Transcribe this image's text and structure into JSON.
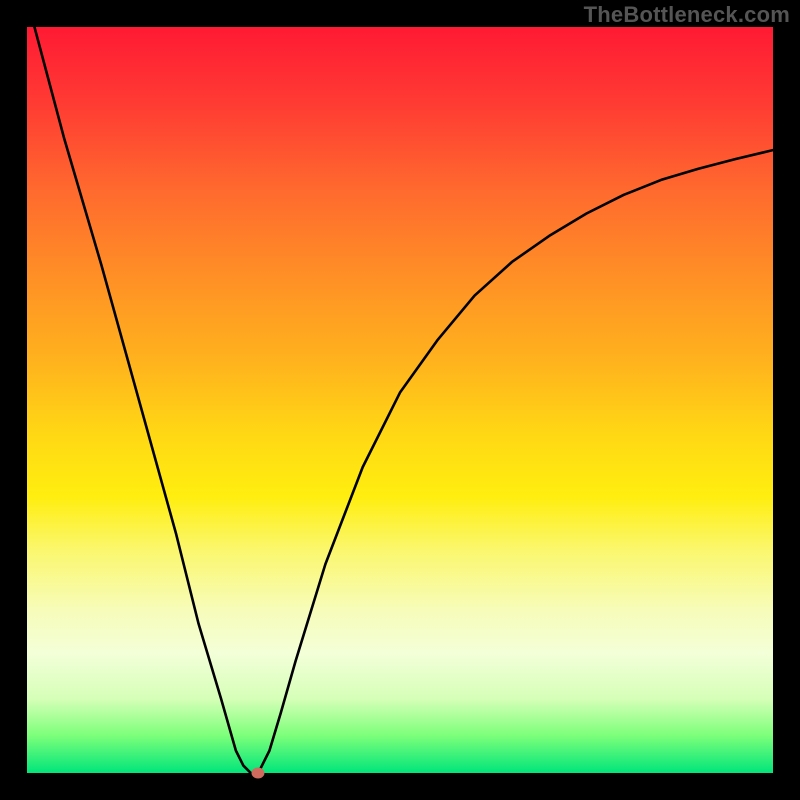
{
  "watermark": "TheBottleneck.com",
  "chart_data": {
    "type": "line",
    "title": "",
    "xlabel": "",
    "ylabel": "",
    "xlim": [
      0,
      100
    ],
    "ylim": [
      0,
      100
    ],
    "background_gradient": {
      "top": "#ff1a33",
      "middle": "#ffd914",
      "bottom": "#00e57a"
    },
    "series": [
      {
        "name": "bottleneck-curve",
        "color": "#000000",
        "x": [
          1,
          5,
          10,
          15,
          20,
          23,
          26,
          28,
          29,
          30,
          31,
          32.5,
          34,
          36,
          40,
          45,
          50,
          55,
          60,
          65,
          70,
          75,
          80,
          85,
          90,
          95,
          100
        ],
        "y": [
          100,
          85,
          68,
          50,
          32,
          20,
          10,
          3,
          1,
          0,
          0,
          3,
          8,
          15,
          28,
          41,
          51,
          58,
          64,
          68.5,
          72,
          75,
          77.5,
          79.5,
          81,
          82.3,
          83.5
        ]
      }
    ],
    "marker": {
      "x": 30.9,
      "y": 0,
      "color": "#cf6a5f"
    },
    "grid": false,
    "legend": false
  }
}
